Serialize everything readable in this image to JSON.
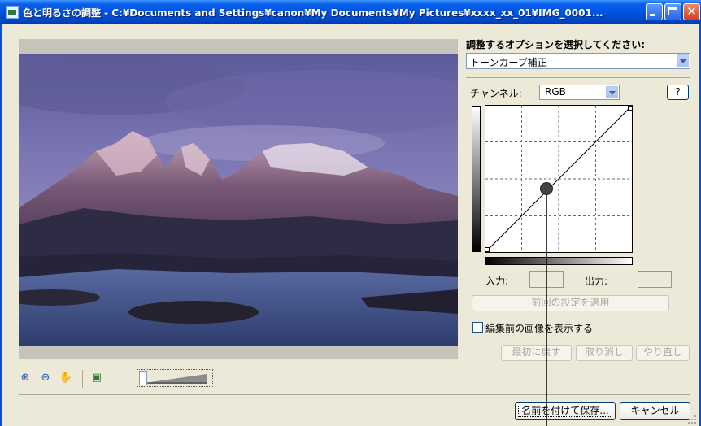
{
  "window": {
    "title": "色と明るさの調整 - C:¥Documents and Settings¥canon¥My Documents¥My Pictures¥xxxx_xx_01¥IMG_0001...",
    "close_glyph": "✕"
  },
  "options": {
    "label": "調整するオプションを選択してください:",
    "selected": "トーンカーブ補正"
  },
  "channel": {
    "label": "チャンネル:",
    "selected": "RGB",
    "help_label": "?"
  },
  "io": {
    "input_label": "入力:",
    "input_value": "",
    "output_label": "出力:",
    "output_value": ""
  },
  "buttons": {
    "apply_previous": "前回の設定を適用",
    "show_before_label": "編集前の画像を表示する",
    "reset": "最初に戻す",
    "undo": "取り消し",
    "redo": "やり直し",
    "save_as": "名前を付けて保存...",
    "cancel": "キャンセル"
  },
  "tools": {
    "zoom_in": "zoom-in-icon",
    "zoom_out": "zoom-out-icon",
    "hand": "hand-icon",
    "fit": "fit-to-window-icon"
  },
  "curve": {
    "control_point_input": 128,
    "control_point_output": 128
  },
  "colors": {
    "titlebar": "#0054e3",
    "dialog_bg": "#ece9d8"
  }
}
